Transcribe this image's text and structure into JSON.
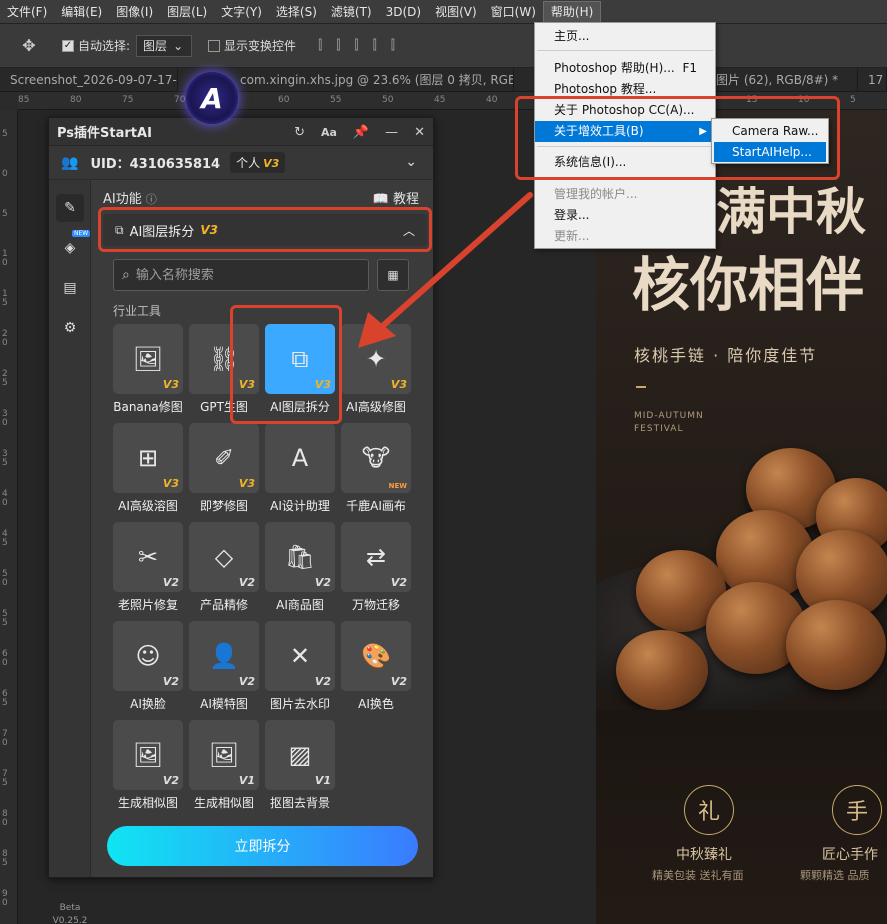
{
  "menubar": {
    "items": [
      "文件(F)",
      "编辑(E)",
      "图像(I)",
      "图层(L)",
      "文字(Y)",
      "选择(S)",
      "滤镜(T)",
      "3D(D)",
      "视图(V)",
      "窗口(W)",
      "帮助(H)"
    ]
  },
  "optionsbar": {
    "auto_select_label": "自动选择:",
    "auto_select_value": "图层",
    "show_transform_label": "显示变换控件"
  },
  "tabs": [
    "Screenshot_2026-09-07-17-04-55",
    "com.xingin.xhs.jpg @ 23.6% (图层 0 拷贝, RGB/8#) *",
    "成图片 (62), RGB/8#) *",
    "17"
  ],
  "ruler": {
    "h": [
      "85",
      "80",
      "75",
      "70",
      "65",
      "60",
      "55",
      "50",
      "45",
      "40",
      "35",
      "30",
      "25",
      "20",
      "15",
      "10",
      "5"
    ],
    "v": [
      "5",
      "0",
      "5",
      "10",
      "15",
      "20",
      "25",
      "30",
      "35",
      "40",
      "45",
      "50",
      "55",
      "60",
      "65",
      "70",
      "75",
      "80",
      "85",
      "90"
    ]
  },
  "help_menu": {
    "items": [
      {
        "label": "主页...",
        "key": ""
      },
      {
        "label": "Photoshop 帮助(H)...",
        "key": "F1"
      },
      {
        "label": "Photoshop 教程...",
        "key": ""
      },
      {
        "label": "关于 Photoshop CC(A)...",
        "key": ""
      },
      {
        "label": "关于增效工具(B)",
        "key": ""
      },
      {
        "label": "系统信息(I)...",
        "key": ""
      },
      {
        "label": "管理我的帐户...",
        "key": ""
      },
      {
        "label": "登录...",
        "key": ""
      },
      {
        "label": "更新...",
        "key": ""
      }
    ],
    "submenu": [
      "Camera Raw...",
      "StartAIHelp..."
    ]
  },
  "plugin": {
    "title": "Ps插件StartAI",
    "uid": "UID：4310635814",
    "plan": "个人",
    "plan_version": "V3",
    "new_badge": "NEW",
    "beta": "Beta",
    "version": "V0.25.2",
    "section_label": "AI功能",
    "tutorial": "教程",
    "current_tool": "AI图层拆分",
    "current_tool_version": "V3",
    "search_placeholder": "输入名称搜索",
    "category": "行业工具",
    "action_button": "立即拆分",
    "tools": [
      {
        "label": "Banana修图",
        "ver": "V3"
      },
      {
        "label": "GPT生图",
        "ver": "V3"
      },
      {
        "label": "AI图层拆分",
        "ver": "V3"
      },
      {
        "label": "AI高级修图",
        "ver": "V3"
      },
      {
        "label": "AI高级溶图",
        "ver": "V3"
      },
      {
        "label": "即梦修图",
        "ver": "V3"
      },
      {
        "label": "AI设计助理",
        "ver": ""
      },
      {
        "label": "千鹿AI画布",
        "ver": "NEW"
      },
      {
        "label": "老照片修复",
        "ver": "V2"
      },
      {
        "label": "产品精修",
        "ver": "V2"
      },
      {
        "label": "AI商品图",
        "ver": "V2"
      },
      {
        "label": "万物迁移",
        "ver": "V2"
      },
      {
        "label": "AI换脸",
        "ver": "V2"
      },
      {
        "label": "AI模特图",
        "ver": "V2"
      },
      {
        "label": "图片去水印",
        "ver": "V2"
      },
      {
        "label": "AI换色",
        "ver": "V2"
      },
      {
        "label": "生成相似图",
        "ver": "V2"
      },
      {
        "label": "生成相似图",
        "ver": "V1"
      },
      {
        "label": "抠图去背景",
        "ver": "V1"
      }
    ]
  },
  "poster": {
    "title_line1": "满中秋",
    "title_line2": "核你相伴",
    "subtitle": "核桃手链 · 陪你度佳节",
    "en_line1": "MID-AUTUMN",
    "en_line2": "FESTIVAL",
    "seal1": "礼",
    "seal2": "手",
    "cap1": "中秋臻礼",
    "cap1_sub": "精美包装 送礼有面",
    "cap2": "匠心手作",
    "cap2_sub": "颗颗精选 品质"
  },
  "colors": {
    "accent_blue": "#3aa9ff",
    "annotation_red": "#d9432e",
    "version_gold": "#f0b429",
    "menu_highlight": "#0078d7"
  }
}
